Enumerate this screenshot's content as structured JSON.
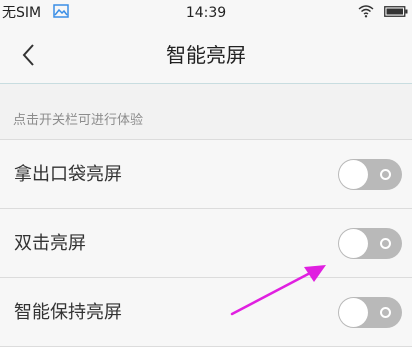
{
  "status_bar": {
    "carrier": "无SIM",
    "time": "14:39",
    "icons": [
      "image-icon",
      "wifi-icon",
      "battery-icon"
    ]
  },
  "header": {
    "title": "智能亮屏",
    "back_icon": "chevron-left-icon"
  },
  "section": {
    "hint": "点击开关栏可进行体验"
  },
  "settings": {
    "items": [
      {
        "label": "拿出口袋亮屏",
        "enabled": false
      },
      {
        "label": "双击亮屏",
        "enabled": false
      },
      {
        "label": "智能保持亮屏",
        "enabled": false
      }
    ]
  },
  "colors": {
    "annotation_arrow": "#e020e0",
    "toggle_off": "#b9b9b9",
    "divider": "#dcdcdc",
    "title_bar_border": "#c8dde0"
  }
}
